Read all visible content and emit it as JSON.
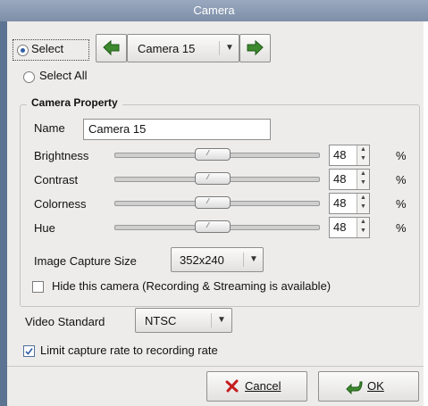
{
  "window": {
    "title": "Camera"
  },
  "select": {
    "select_label": "Select",
    "select_all_label": "Select All",
    "selected": "select",
    "camera_value": "Camera 15"
  },
  "camera_property": {
    "group_title": "Camera Property",
    "name_label": "Name",
    "name_value": "Camera 15",
    "sliders": [
      {
        "label": "Brightness",
        "value": "48",
        "unit": "%"
      },
      {
        "label": "Contrast",
        "value": "48",
        "unit": "%"
      },
      {
        "label": "Colorness",
        "value": "48",
        "unit": "%"
      },
      {
        "label": "Hue",
        "value": "48",
        "unit": "%"
      }
    ],
    "capture_size_label": "Image Capture Size",
    "capture_size_value": "352x240",
    "hide_camera_label": "Hide this camera (Recording & Streaming is available)",
    "hide_camera_checked": false
  },
  "video_standard": {
    "label": "Video Standard",
    "value": "NTSC"
  },
  "limit_capture": {
    "label": "Limit capture rate to recording rate",
    "checked": true
  },
  "buttons": {
    "cancel": "Cancel",
    "ok": "OK"
  },
  "colors": {
    "titlebar": "#8b9bb3",
    "accent": "#2f5fa8",
    "arrow": "#3d8a2e",
    "dialog_bg": "#edeceb"
  }
}
